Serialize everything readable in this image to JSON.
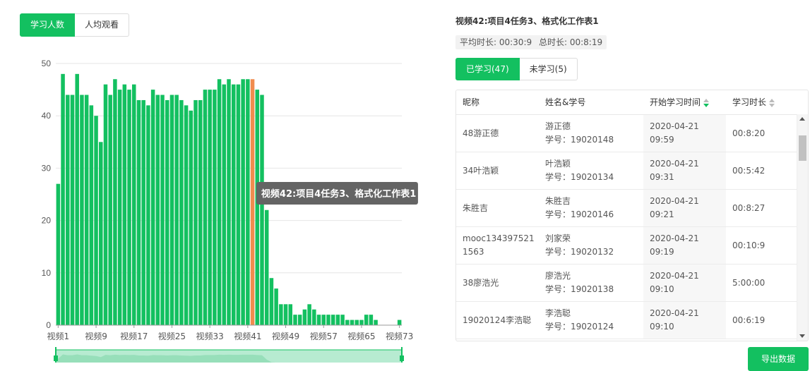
{
  "left_tabs": {
    "learners": "学习人数",
    "avg_views": "人均观看"
  },
  "tooltip": "视频42:项目4任务3、格式化工作表1",
  "colors": {
    "bar": "#13c060",
    "highlight": "#f08c4e",
    "tooltip_bg": "#646464"
  },
  "chart_data": {
    "type": "bar",
    "x": [
      "视频1",
      "视频2",
      "视频3",
      "视频4",
      "视频5",
      "视频6",
      "视频7",
      "视频8",
      "视频9",
      "视频10",
      "视频11",
      "视频12",
      "视频13",
      "视频14",
      "视频15",
      "视频16",
      "视频17",
      "视频18",
      "视频19",
      "视频20",
      "视频21",
      "视频22",
      "视频23",
      "视频24",
      "视频25",
      "视频26",
      "视频27",
      "视频28",
      "视频29",
      "视频30",
      "视频31",
      "视频32",
      "视频33",
      "视频34",
      "视频35",
      "视频36",
      "视频37",
      "视频38",
      "视频39",
      "视频40",
      "视频41",
      "视频42",
      "视频43",
      "视频44",
      "视频45",
      "视频46",
      "视频47",
      "视频48",
      "视频49",
      "视频50",
      "视频51",
      "视频52",
      "视频53",
      "视频54",
      "视频55",
      "视频56",
      "视频57",
      "视频58",
      "视频59",
      "视频60",
      "视频61",
      "视频62",
      "视频63",
      "视频64",
      "视频65",
      "视频66",
      "视频67",
      "视频68",
      "视频69",
      "视频70",
      "视频71",
      "视频72",
      "视频73"
    ],
    "values": [
      27,
      48,
      44,
      44,
      48,
      44,
      44,
      42,
      40,
      35,
      46,
      44,
      47,
      45,
      46,
      45,
      46,
      43,
      43,
      42,
      45,
      44,
      44,
      43,
      44,
      44,
      43,
      42,
      41,
      43,
      43,
      45,
      45,
      45,
      47,
      46,
      47,
      46,
      46,
      47,
      47,
      47,
      45,
      44,
      22,
      9,
      7,
      4,
      4,
      4,
      2,
      2,
      3,
      4,
      3,
      2,
      2,
      2,
      2,
      2,
      2,
      1,
      1,
      1,
      1,
      2,
      2,
      1,
      0,
      0,
      0,
      0,
      1
    ],
    "highlight_index": 41,
    "xticks": [
      "视频1",
      "视频9",
      "视频17",
      "视频25",
      "视频33",
      "视频41",
      "视频49",
      "视频57",
      "视频65",
      "视频73"
    ],
    "yticks": [
      0,
      10,
      20,
      30,
      40,
      50
    ],
    "ylim": [
      0,
      50
    ],
    "grid": true
  },
  "right": {
    "title": "视频42:项目4任务3、格式化工作表1",
    "avg_duration": "平均时长: 00:30:9",
    "total_duration": "总时长: 00:8:19",
    "tab_learned": "已学习(47)",
    "tab_unlearned": "未学习(5)",
    "headers": {
      "nickname": "昵称",
      "name_id": "姓名&学号",
      "start_time": "开始学习时间",
      "duration": "学习时长"
    },
    "rows": [
      {
        "nick": "48游正德",
        "name": "游正德",
        "sid": "学号：19020148",
        "start": "2020-04-21 09:59",
        "dur": "00:8:20"
      },
      {
        "nick": "34叶浩颖",
        "name": "叶浩颖",
        "sid": "学号：19020134",
        "start": "2020-04-21 09:31",
        "dur": "00:5:42"
      },
      {
        "nick": "朱胜吉",
        "name": "朱胜吉",
        "sid": "学号：19020146",
        "start": "2020-04-21 09:21",
        "dur": "00:8:27"
      },
      {
        "nick": "mooc1343975211563",
        "name": "刘家荣",
        "sid": "学号：19020132",
        "start": "2020-04-21 09:19",
        "dur": "00:10:9"
      },
      {
        "nick": "38廖浩光",
        "name": "廖浩光",
        "sid": "学号：19020138",
        "start": "2020-04-21 09:10",
        "dur": "5:00:00"
      },
      {
        "nick": "19020124李浩聪",
        "name": "李浩聪",
        "sid": "学号：19020124",
        "start": "2020-04-21 09:10",
        "dur": "00:6:19"
      }
    ],
    "export_label": "导出数据"
  }
}
